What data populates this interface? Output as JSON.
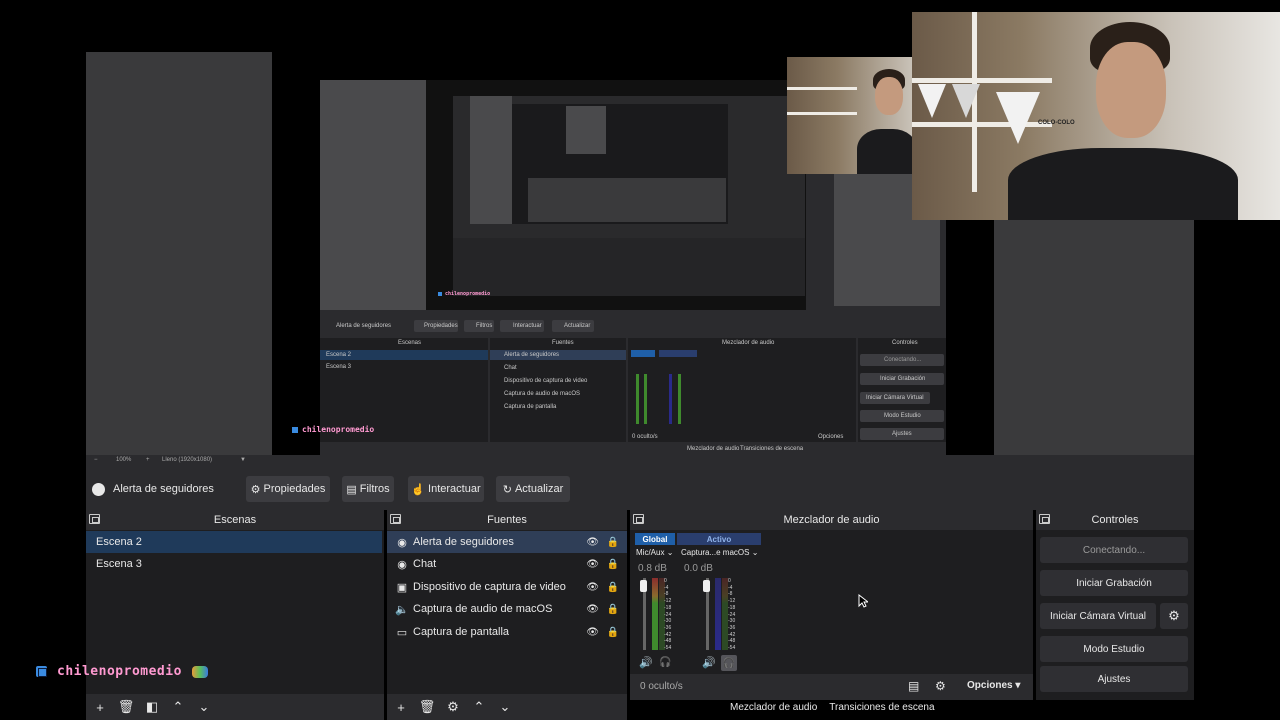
{
  "context": {
    "source_name": "Alerta de seguidores",
    "properties": "Propiedades",
    "filters": "Filtros",
    "interact": "Interactuar",
    "refresh": "Actualizar"
  },
  "scenes": {
    "title": "Escenas",
    "items": [
      "Escena 2",
      "Escena 3"
    ],
    "selected_index": 0
  },
  "sources": {
    "title": "Fuentes",
    "items": [
      {
        "label": "Alerta de seguidores",
        "icon": "browser-icon"
      },
      {
        "label": "Chat",
        "icon": "browser-icon"
      },
      {
        "label": "Dispositivo de captura de video",
        "icon": "camera-icon"
      },
      {
        "label": "Captura de audio de macOS",
        "icon": "speaker-icon"
      },
      {
        "label": "Captura de pantalla",
        "icon": "monitor-icon"
      }
    ]
  },
  "mixer": {
    "title": "Mezclador de audio",
    "tab_global": "Global",
    "tab_active": "Activo",
    "ch1_name": "Mic/Aux",
    "ch2_name": "Captura...e macOS",
    "ch1_db": "0.8 dB",
    "ch2_db": "0.0 dB",
    "scale": [
      "0",
      "-4",
      "-8",
      "-12",
      "-18",
      "-24",
      "-30",
      "-36",
      "-42",
      "-48",
      "-54",
      "-60"
    ],
    "hidden": "0 oculto/s",
    "options": "Opciones",
    "colors": {
      "global_tab": "#1f5fa8",
      "active_tab": "#2a3e6e"
    }
  },
  "controls": {
    "title": "Controles",
    "connecting": "Conectando...",
    "start_recording": "Iniciar Grabación",
    "start_virtual_cam": "Iniciar Cámara Virtual",
    "studio_mode": "Modo Estudio",
    "settings": "Ajustes"
  },
  "bottom_tabs": [
    "Mezclador de audio",
    "Transiciones de escena"
  ],
  "overlay_username": "chilenopromedio",
  "preview_status": {
    "zoom": "100%",
    "fill": "Lleno (1920x1080)"
  },
  "webcam_text": "COLO-COLO"
}
